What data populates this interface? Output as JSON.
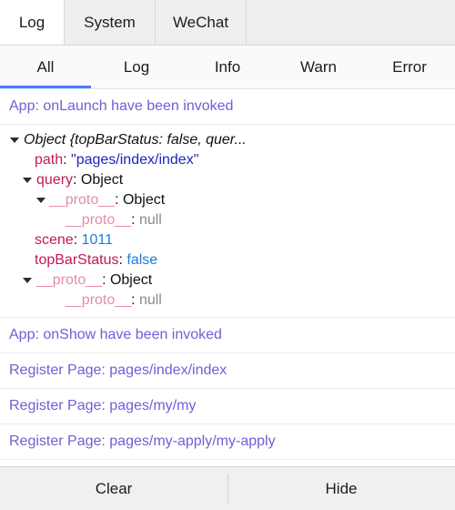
{
  "panel_tabs": [
    {
      "label": "Log",
      "active": true
    },
    {
      "label": "System",
      "active": false
    },
    {
      "label": "WeChat",
      "active": false
    }
  ],
  "filter_tabs": [
    {
      "label": "All",
      "active": true
    },
    {
      "label": "Log",
      "active": false
    },
    {
      "label": "Info",
      "active": false
    },
    {
      "label": "Warn",
      "active": false
    },
    {
      "label": "Error",
      "active": false
    }
  ],
  "logs": {
    "launch_message": "App: onLaunch have been invoked",
    "show_message": "App: onShow have been invoked",
    "register_index": "Register Page: pages/index/index",
    "register_my": "Register Page: pages/my/my",
    "register_my_apply": "Register Page: pages/my-apply/my-apply"
  },
  "object_tree": {
    "summary": "Object {topBarStatus: false, quer...",
    "path_key": "path",
    "path_sep": ": ",
    "path_value": "\"pages/index/index\"",
    "query_key": "query",
    "query_sep": ": ",
    "query_value": "Object",
    "query_proto_key": "__proto__",
    "query_proto_sep": ": ",
    "query_proto_value": "Object",
    "query_proto_proto_key": "__proto__",
    "query_proto_proto_sep": ": ",
    "query_proto_proto_value": "null",
    "scene_key": "scene",
    "scene_sep": ": ",
    "scene_value": "1011",
    "topbar_key": "topBarStatus",
    "topbar_sep": ": ",
    "topbar_value": "false",
    "root_proto_key": "__proto__",
    "root_proto_sep": ": ",
    "root_proto_value": "Object",
    "root_proto_proto_key": "__proto__",
    "root_proto_proto_sep": ": ",
    "root_proto_proto_value": "null"
  },
  "bottom_bar": {
    "clear_label": "Clear",
    "hide_label": "Hide"
  },
  "colors": {
    "accent_underline": "#4a7dff",
    "log_message": "#6e61d6",
    "property_key": "#c2185b",
    "proto_key": "#e48ab0",
    "string_value": "#2222bb",
    "number_value": "#1c7cd6",
    "null_value": "#8a8a8a",
    "tab_inactive_bg": "#eeeef0",
    "bottom_bar_bg": "#f0f0f2"
  }
}
